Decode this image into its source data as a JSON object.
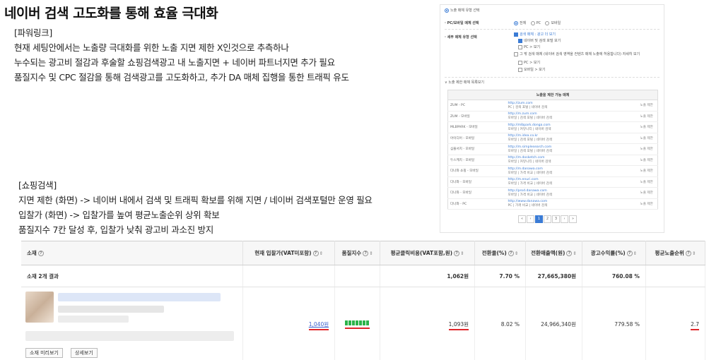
{
  "title": "네이버 검색 고도화를 통해 효율 극대화",
  "powerlink": {
    "heading": "[파워링크]",
    "lines": [
      "현재 세팅안에서는 노출량 극대화를 위한 노출 지면 제한 X인것으로 추측하나",
      "누수되는 광고비 절감과 후술할 쇼핑검색광고 내 노출지면 + 네이버 파트너지면 추가 필요",
      "품질지수 및 CPC 절감을 통해 검색광고를 고도화하고, 추가 DA 매체 집행을 통한 트래픽 유도"
    ]
  },
  "shopping": {
    "heading": "[쇼핑검색]",
    "lines": [
      "지면 제한 (화면) -> 네이버 내에서 검색 및 트래픽 확보를 위해 지면 / 네이버 검색포털만 운영 필요",
      "입찰가 (화면) -> 입찰가를 높여 평균노출순위 상위 확보",
      "품질지수 7칸 달성 후, 입찰가 낮춰 광고비 과소진 방지"
    ]
  },
  "panel": {
    "section_title": "노출 매체 유형 선택",
    "row1_label": "· PC/모바일 매체 선택",
    "row1_options": [
      "전체",
      "PC",
      "모바일"
    ],
    "row2_label": "· 세부 매체 유형 선택",
    "row2_options": [
      "검색 매체 : 광고 더 보기",
      "네이버 및 검색 포털 보기",
      "PC > 보기",
      "그 밖 검색 매체 (네이버 검색 영역을 컨텐츠 매체 노출에 허용합니다) 자세히 보기",
      "PC > 보기",
      "모바일 > 보기"
    ],
    "list_label": "노출 제한 매체 목록보기",
    "table_header": "노출을 제한 가능 매체",
    "rows": [
      {
        "name": "ZUM - PC",
        "url": "http://zum.com",
        "desc": "PC | 검색 포털 | 네이버 검색",
        "action": "노출 제한"
      },
      {
        "name": "ZUM - 모바일",
        "url": "http://m.zum.com",
        "desc": "모바일 | 검색 포털 | 네이버 검색",
        "action": "노출 제한"
      },
      {
        "name": "MLBPARK - 모바일",
        "url": "http://mlbpark.donga.com",
        "desc": "모바일 | 커뮤니티 | 네이버 검색",
        "action": "노출 제한"
      },
      {
        "name": "아이디어 - 모바일",
        "url": "http://m.idea.co.kr",
        "desc": "모바일 | 검색 포털 | 네이버 검색",
        "action": "노출 제한"
      },
      {
        "name": "심플서치 - 모바일",
        "url": "http://m.simplesearch.com",
        "desc": "모바일 | 검색 포털 | 네이버 검색",
        "action": "노출 제한"
      },
      {
        "name": "두스케치 - 모바일",
        "url": "http://m.dosketch.com",
        "desc": "모바일 | 커뮤니티 | 네이버 검색",
        "action": "노출 제한"
      },
      {
        "name": "다나와 쇼핑 - 모바일",
        "url": "http://m.danawa.com",
        "desc": "모바일 | 가격 비교 | 네이버 검색",
        "action": "노출 제한"
      },
      {
        "name": "다나와 - 모바일",
        "url": "http://m.enuri.com",
        "desc": "모바일 | 가격 비교 | 네이버 검색",
        "action": "노출 제한"
      },
      {
        "name": "다나와 - 모바일",
        "url": "http://prod.danawa.com",
        "desc": "모바일 | 가격 비교 | 네이버 검색",
        "action": "노출 제한"
      },
      {
        "name": "다나와 - PC",
        "url": "http://www.danawa.com",
        "desc": "PC | 가격 비교 | 네이버 검색",
        "action": "노출 제한"
      }
    ],
    "pager": [
      "«",
      "‹",
      "1",
      "2",
      "3",
      "›",
      "»"
    ]
  },
  "keyword_table": {
    "headers": [
      "소재",
      "현재 입찰가(VAT미포함)",
      "품질지수",
      "평균클릭비용(VAT포함,원)",
      "전환율(%)",
      "전환매출액(원)",
      "광고수익률(%)",
      "평균노출순위"
    ],
    "summary": {
      "label": "소재 2개 결과",
      "cpc": "1,062원",
      "cvr": "7.70 %",
      "revenue": "27,665,380원",
      "roas": "760.08 %"
    },
    "row": {
      "bid": "1,040원",
      "cpc": "1,093원",
      "cvr": "8.02 %",
      "revenue": "24,966,340원",
      "roas": "779.58 %",
      "rank": "2.7",
      "quality_level": 7
    },
    "buttons": [
      "소재 미리보기",
      "상세보기"
    ]
  },
  "colors": {
    "accent": "#3a7bd5",
    "highlight": "#e0262b",
    "quality": "#2db34a"
  }
}
